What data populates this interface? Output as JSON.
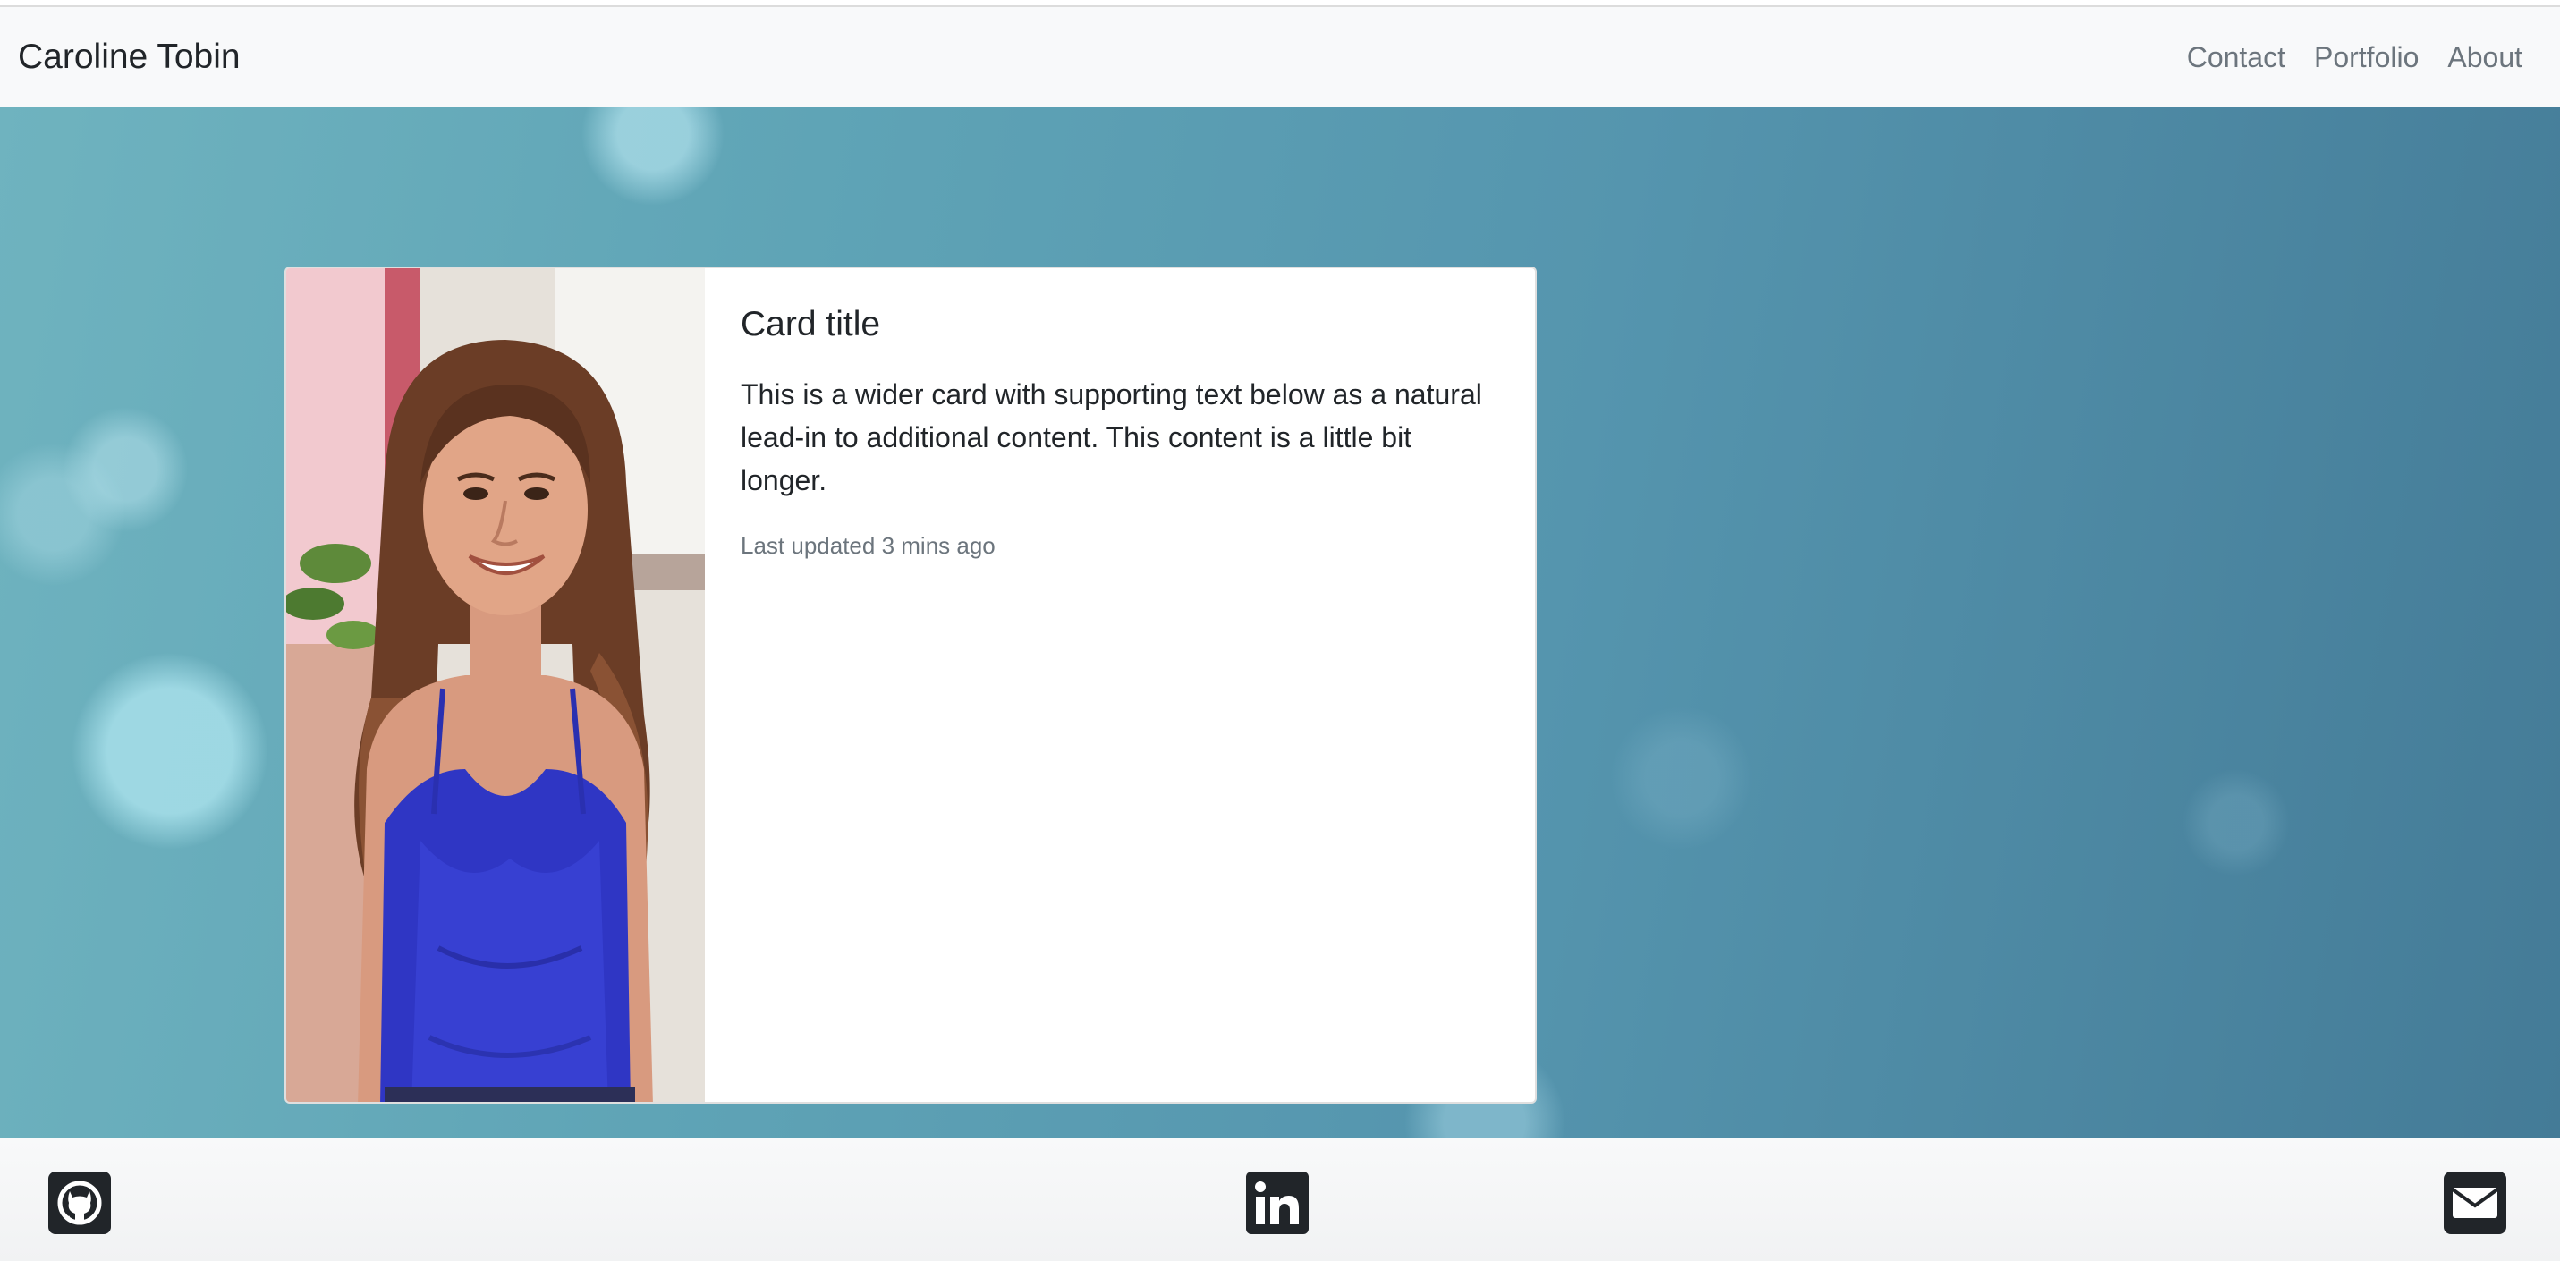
{
  "navbar": {
    "brand": "Caroline Tobin",
    "links": [
      "Contact",
      "Portfolio",
      "About"
    ]
  },
  "card": {
    "title": "Card title",
    "text": "This is a wider card with supporting text below as a natural lead-in to additional content. This content is a little bit longer.",
    "updated": "Last updated 3 mins ago"
  },
  "footer": {
    "icons": [
      "github-icon",
      "linkedin-icon",
      "envelope-icon"
    ]
  },
  "colors": {
    "navbar_bg": "#f8f9fa",
    "muted_text": "#6c757d",
    "body_text": "#212529",
    "hero_blue": "#5595ae"
  }
}
